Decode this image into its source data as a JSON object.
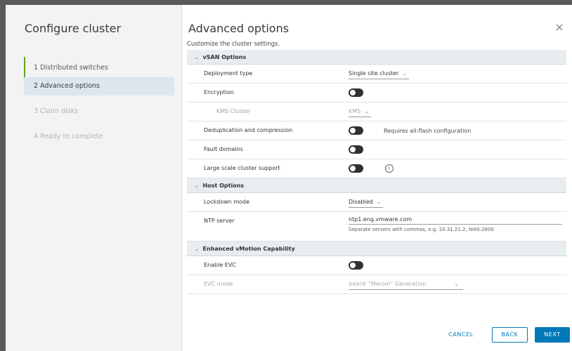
{
  "wizard": {
    "title": "Configure cluster",
    "steps": [
      {
        "label": "1 Distributed switches",
        "state": "completed"
      },
      {
        "label": "2 Advanced options",
        "state": "active"
      },
      {
        "label": "3 Claim disks",
        "state": "disabled"
      },
      {
        "label": "4 Ready to complete",
        "state": "disabled"
      }
    ]
  },
  "panel": {
    "title": "Advanced options",
    "subtitle": "Customize the cluster settings.",
    "close_icon": "×"
  },
  "vsan": {
    "header": "vSAN Options",
    "deployment_type_label": "Deployment type",
    "deployment_type_value": "Single site cluster",
    "encryption_label": "Encryption",
    "kms_cluster_label": "KMS Cluster",
    "kms_cluster_value": "KMS",
    "dedup_label": "Deduplication and compression",
    "dedup_note": "Requires all-flash configuration",
    "fault_domains_label": "Fault domains",
    "large_scale_label": "Large scale cluster support",
    "info_icon": "i"
  },
  "host": {
    "header": "Host Options",
    "lockdown_label": "Lockdown mode",
    "lockdown_value": "Disabled",
    "ntp_label": "NTP server",
    "ntp_value": "ntp1.eng.vmware.com",
    "ntp_hint": "Separate servers with commas, e.g. 10.31.21.2, fe00:2800"
  },
  "evc": {
    "header": "Enhanced vMotion Capability",
    "enable_label": "Enable EVC",
    "mode_label": "EVC mode",
    "mode_value": "Intel® \"Merom\" Generation"
  },
  "toggles": {
    "encryption": false,
    "dedup": false,
    "fault_domains": false,
    "large_scale": false,
    "enable_evc": false
  },
  "footer": {
    "cancel": "CANCEL",
    "back": "BACK",
    "next": "NEXT"
  },
  "colors": {
    "accent": "#0079b8",
    "completed_step": "#62a420",
    "active_step_bg": "#dce6ec",
    "section_bg": "#e8edf0"
  }
}
